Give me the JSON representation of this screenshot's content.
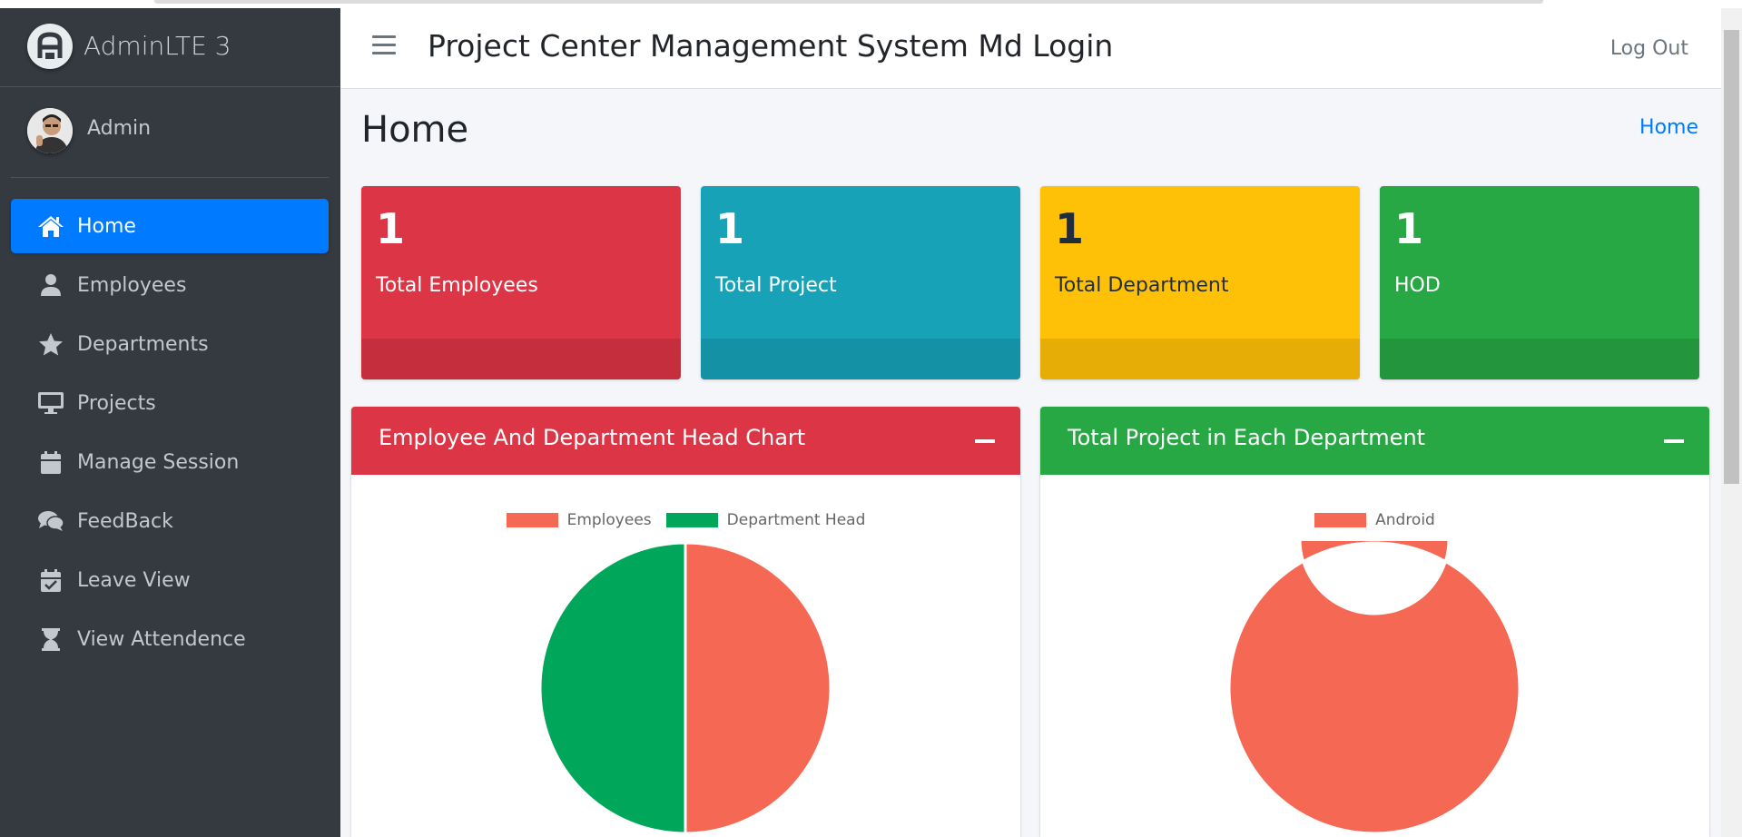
{
  "brand": {
    "name": "AdminLTE 3"
  },
  "user": {
    "name": "Admin"
  },
  "sidebar": {
    "items": [
      {
        "label": "Home",
        "icon": "home-icon",
        "active": true
      },
      {
        "label": "Employees",
        "icon": "user-icon"
      },
      {
        "label": "Departments",
        "icon": "star-icon"
      },
      {
        "label": "Projects",
        "icon": "desktop-icon"
      },
      {
        "label": "Manage Session",
        "icon": "calendar-icon"
      },
      {
        "label": "FeedBack",
        "icon": "comments-icon"
      },
      {
        "label": "Leave View",
        "icon": "calendar-check-icon"
      },
      {
        "label": "View Attendence",
        "icon": "hourglass-icon"
      }
    ]
  },
  "navbar": {
    "title": "Project Center Management System Md Login",
    "logout": "Log Out"
  },
  "page": {
    "title": "Home",
    "breadcrumb": "Home"
  },
  "stats": [
    {
      "value": "1",
      "label": "Total Employees",
      "color": "#dc3545"
    },
    {
      "value": "1",
      "label": "Total Project",
      "color": "#17a2b8"
    },
    {
      "value": "1",
      "label": "Total Department",
      "color": "#ffc107"
    },
    {
      "value": "1",
      "label": "HOD",
      "color": "#28a745"
    }
  ],
  "cards": [
    {
      "title": "Employee And Department Head Chart",
      "color": "#dc3545"
    },
    {
      "title": "Total Project in Each Department",
      "color": "#28a745"
    }
  ],
  "chart_data": [
    {
      "type": "pie",
      "categories": [
        "Employees",
        "Department Head"
      ],
      "values": [
        1,
        1
      ],
      "colors": [
        "#f56954",
        "#00a65a"
      ],
      "legend": "top"
    },
    {
      "type": "pie",
      "subtype": "doughnut",
      "categories": [
        "Android"
      ],
      "values": [
        1
      ],
      "colors": [
        "#f56954"
      ],
      "legend": "top"
    }
  ]
}
